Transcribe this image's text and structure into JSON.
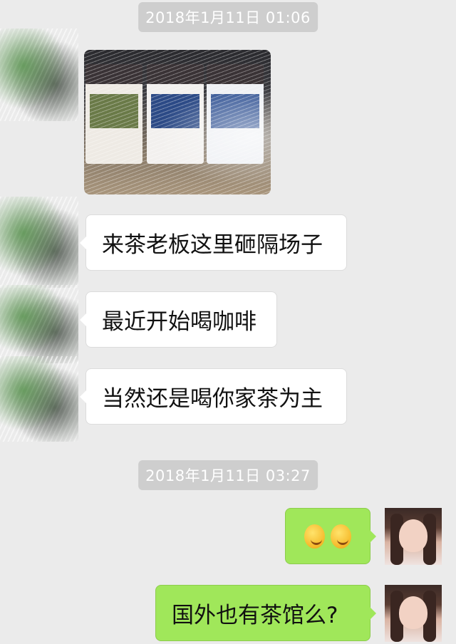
{
  "timestamps": [
    "2018年1月11日 01:06",
    "2018年1月11日 03:27"
  ],
  "messages": {
    "m1": "来茶老板这里砸隔场子",
    "m2": "最近开始喝咖啡",
    "m3": "当然还是喝你家茶为主",
    "m5": "国外也有茶馆么?"
  },
  "icons": {
    "emoji": "grinning-face-with-hand-icon"
  },
  "colors": {
    "background": "#ebebeb",
    "outgoing_bubble": "#a0e75a",
    "incoming_bubble": "#ffffff",
    "timestamp_badge": "#cecece"
  }
}
